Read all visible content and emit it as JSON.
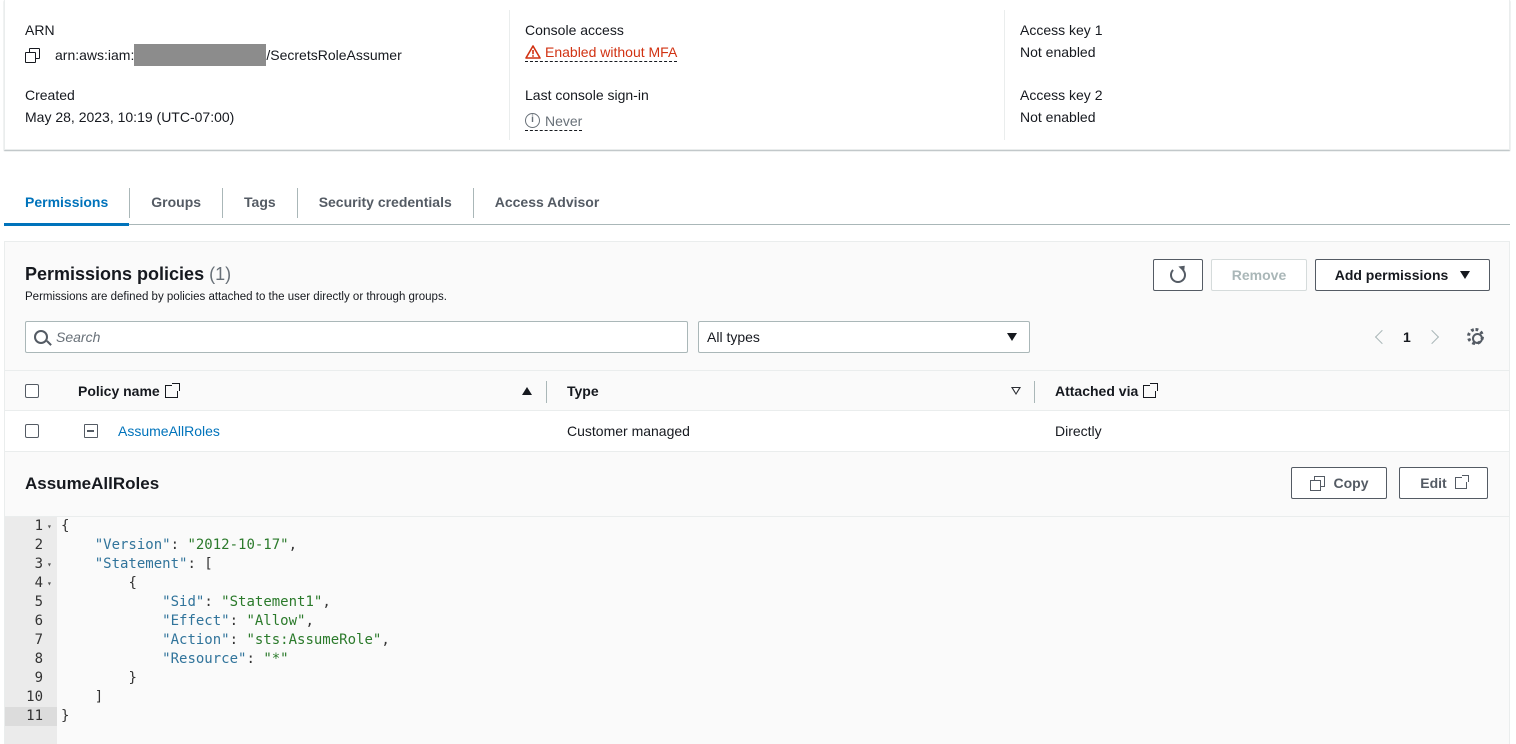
{
  "summary": {
    "arn_label": "ARN",
    "arn_prefix": "arn:aws:iam:",
    "arn_suffix": "/SecretsRoleAssumer",
    "created_label": "Created",
    "created_value": "May 28, 2023, 10:19 (UTC-07:00)",
    "console_access_label": "Console access",
    "console_access_value": "Enabled without MFA",
    "last_signin_label": "Last console sign-in",
    "last_signin_value": "Never",
    "access_key1_label": "Access key 1",
    "access_key1_value": "Not enabled",
    "access_key2_label": "Access key 2",
    "access_key2_value": "Not enabled"
  },
  "tabs": [
    {
      "label": "Permissions"
    },
    {
      "label": "Groups"
    },
    {
      "label": "Tags"
    },
    {
      "label": "Security credentials"
    },
    {
      "label": "Access Advisor"
    }
  ],
  "permissions": {
    "title": "Permissions policies",
    "count": "(1)",
    "subtitle": "Permissions are defined by policies attached to the user directly or through groups.",
    "remove_label": "Remove",
    "add_label": "Add permissions",
    "search_placeholder": "Search",
    "filter_value": "All types",
    "page_number": "1",
    "columns": {
      "policy_name": "Policy name",
      "type": "Type",
      "attached_via": "Attached via"
    },
    "rows": [
      {
        "name": "AssumeAllRoles",
        "type": "Customer managed",
        "attached_via": "Directly"
      }
    ]
  },
  "detail": {
    "title": "AssumeAllRoles",
    "copy_label": "Copy",
    "edit_label": "Edit",
    "line_numbers": [
      "1",
      "2",
      "3",
      "4",
      "5",
      "6",
      "7",
      "8",
      "9",
      "10",
      "11"
    ],
    "code": {
      "l1": "{",
      "l2_key": "\"Version\"",
      "l2_val": "\"2012-10-17\"",
      "l3_key": "\"Statement\"",
      "l3_rest": ": [",
      "l4": "{",
      "l5_key": "\"Sid\"",
      "l5_val": "\"Statement1\"",
      "l6_key": "\"Effect\"",
      "l6_val": "\"Allow\"",
      "l7_key": "\"Action\"",
      "l7_val": "\"sts:AssumeRole\"",
      "l8_key": "\"Resource\"",
      "l8_val": "\"*\"",
      "l9": "}",
      "l10": "]",
      "l11": "}"
    }
  }
}
